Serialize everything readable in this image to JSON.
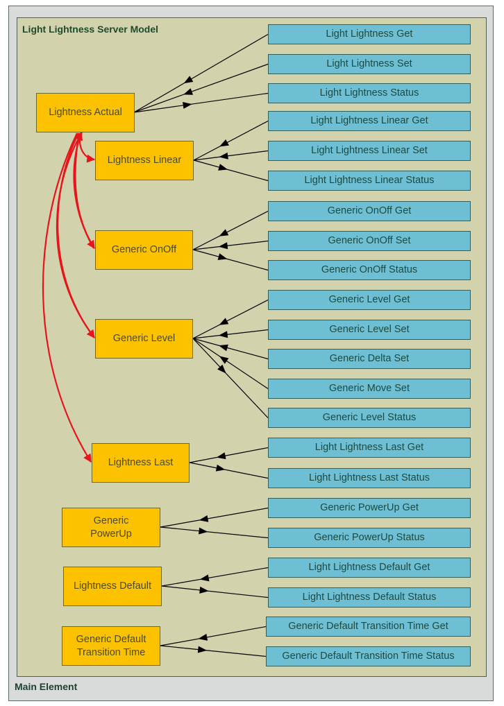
{
  "frame": {
    "title": "Main Element"
  },
  "panel": {
    "title": "Light Lightness Server Model"
  },
  "colors": {
    "state_fill": "#fcc200",
    "message_fill": "#6fbfd4",
    "binding_arrow": "#e8141c",
    "message_arrow": "#000000"
  },
  "states": [
    {
      "id": "actual",
      "label": "Lightness Actual"
    },
    {
      "id": "linear",
      "label": "Lightness Linear"
    },
    {
      "id": "onoff",
      "label": "Generic OnOff"
    },
    {
      "id": "level",
      "label": "Generic Level"
    },
    {
      "id": "last",
      "label": "Lightness Last"
    },
    {
      "id": "powerup",
      "label": "Generic PowerUp"
    },
    {
      "id": "default",
      "label": "Lightness Default"
    },
    {
      "id": "dtt",
      "label": "Generic Default Transition Time"
    }
  ],
  "messages": [
    {
      "label": "Light Lightness Get",
      "state": "actual",
      "direction": "in"
    },
    {
      "label": "Light Lightness Set",
      "state": "actual",
      "direction": "in"
    },
    {
      "label": "Light Lightness Status",
      "state": "actual",
      "direction": "out"
    },
    {
      "label": "Light Lightness Linear Get",
      "state": "linear",
      "direction": "in"
    },
    {
      "label": "Light Lightness Linear Set",
      "state": "linear",
      "direction": "in"
    },
    {
      "label": "Light Lightness Linear Status",
      "state": "linear",
      "direction": "out"
    },
    {
      "label": "Generic OnOff Get",
      "state": "onoff",
      "direction": "in"
    },
    {
      "label": "Generic OnOff Set",
      "state": "onoff",
      "direction": "in"
    },
    {
      "label": "Generic OnOff Status",
      "state": "onoff",
      "direction": "out"
    },
    {
      "label": "Generic Level Get",
      "state": "level",
      "direction": "in"
    },
    {
      "label": "Generic Level Set",
      "state": "level",
      "direction": "in"
    },
    {
      "label": "Generic Delta Set",
      "state": "level",
      "direction": "in"
    },
    {
      "label": "Generic Move Set",
      "state": "level",
      "direction": "in"
    },
    {
      "label": "Generic Level Status",
      "state": "level",
      "direction": "out"
    },
    {
      "label": "Light Lightness Last Get",
      "state": "last",
      "direction": "in"
    },
    {
      "label": "Light Lightness Last Status",
      "state": "last",
      "direction": "out"
    },
    {
      "label": "Generic PowerUp Get",
      "state": "powerup",
      "direction": "in"
    },
    {
      "label": "Generic PowerUp Status",
      "state": "powerup",
      "direction": "out"
    },
    {
      "label": "Light Lightness Default Get",
      "state": "default",
      "direction": "in"
    },
    {
      "label": "Light Lightness Default Status",
      "state": "default",
      "direction": "out"
    },
    {
      "label": "Generic Default Transition Time Get",
      "state": "dtt",
      "direction": "in"
    },
    {
      "label": "Generic Default Transition Time Status",
      "state": "dtt",
      "direction": "out"
    }
  ],
  "bindings": [
    {
      "from": "actual",
      "to": "linear",
      "bidirectional": false
    },
    {
      "from": "actual",
      "to": "onoff",
      "bidirectional": true
    },
    {
      "from": "actual",
      "to": "level",
      "bidirectional": true
    },
    {
      "from": "actual",
      "to": "last",
      "bidirectional": false
    }
  ]
}
